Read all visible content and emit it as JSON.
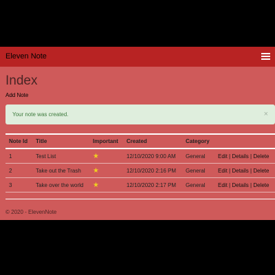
{
  "navbar": {
    "brand": "Eleven Note",
    "menu_icon": "hamburger-menu-icon"
  },
  "page": {
    "title": "Index",
    "add_note": "Add Note"
  },
  "alert": {
    "message": "Your note was created.",
    "close": "×"
  },
  "table": {
    "headers": [
      "Note Id",
      "Title",
      "Important",
      "Created",
      "Category"
    ],
    "rows": [
      {
        "id": "1",
        "title": "Test List",
        "important": "★",
        "created": "12/10/2020 9:00 AM",
        "category": "General"
      },
      {
        "id": "2",
        "title": "Take out the Trash",
        "important": "★",
        "created": "12/10/2020 2:16 PM",
        "category": "General"
      },
      {
        "id": "3",
        "title": "Take over the world",
        "important": "★",
        "created": "12/10/2020 2:17 PM",
        "category": "General"
      }
    ],
    "actions": {
      "edit": "Edit",
      "details": "Details",
      "delete": "Delete",
      "separator": "|"
    }
  },
  "footer": {
    "text": "© 2020 - ElevenNote"
  },
  "colors": {
    "navbar": "#b82323",
    "body": "#cf5a5a",
    "alert_bg": "#dfeedd",
    "alert_text": "#3c7a3c",
    "star": "#f0d020"
  }
}
